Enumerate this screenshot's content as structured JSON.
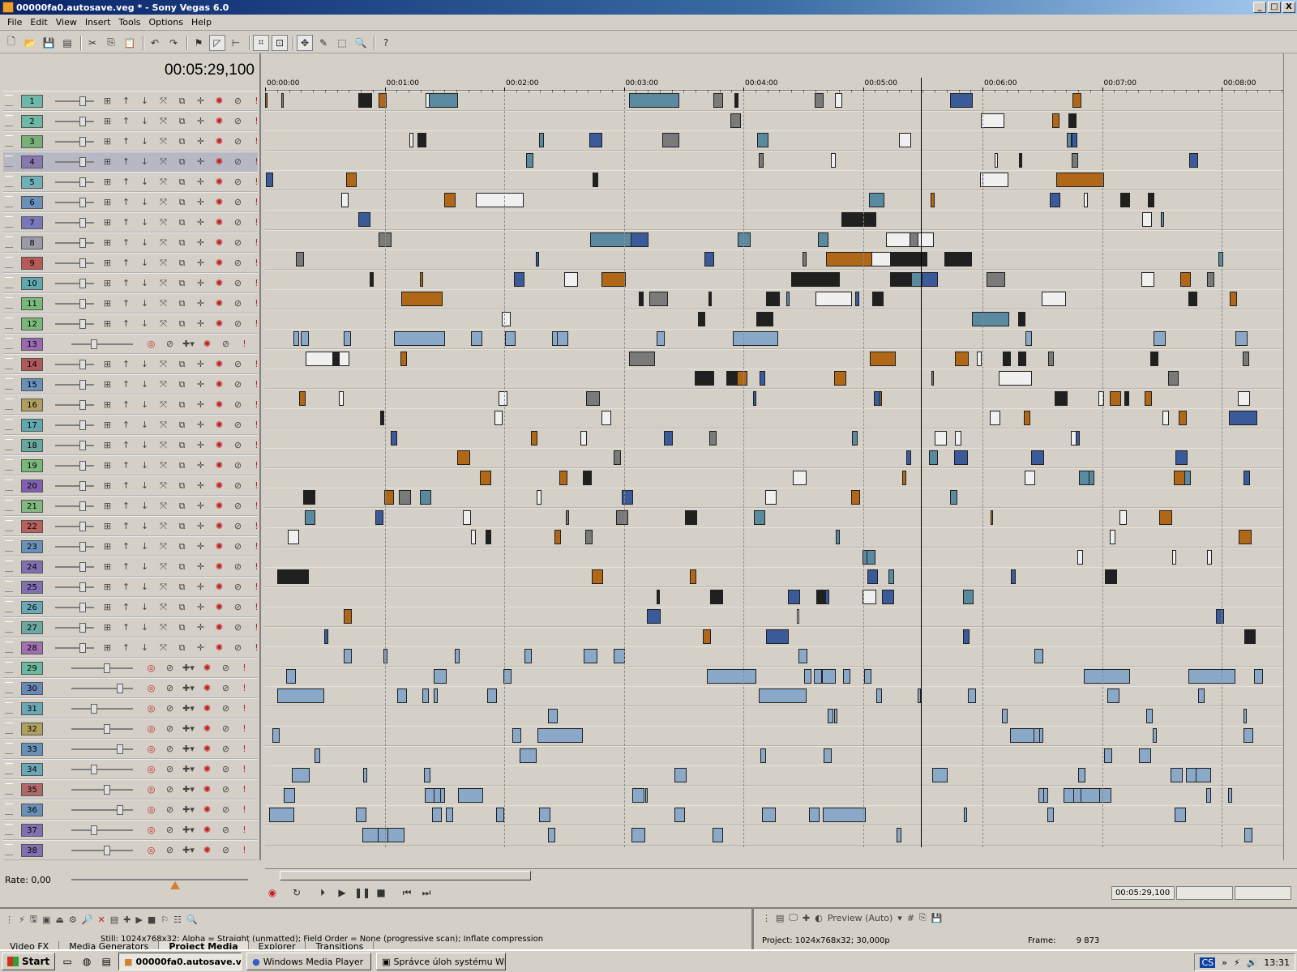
{
  "window": {
    "title": "00000fa0.autosave.veg * - Sony Vegas 6.0",
    "min": "_",
    "max": "□",
    "close": "X"
  },
  "menu": [
    "File",
    "Edit",
    "View",
    "Insert",
    "Tools",
    "Options",
    "Help"
  ],
  "timecode": "00:05:29,100",
  "ruler": [
    "00:00:00",
    "00:01:00",
    "00:02:00",
    "00:03:00",
    "00:04:00",
    "00:05:00",
    "00:06:00",
    "00:07:00",
    "00:08:00"
  ],
  "tracks": [
    {
      "n": "1",
      "c": "#6fb8a8",
      "kind": "video"
    },
    {
      "n": "2",
      "c": "#6fb8a8",
      "kind": "video"
    },
    {
      "n": "3",
      "c": "#78b078",
      "kind": "video"
    },
    {
      "n": "4",
      "c": "#8878b0",
      "kind": "video",
      "sel": true
    },
    {
      "n": "5",
      "c": "#6fb0b8",
      "kind": "video"
    },
    {
      "n": "6",
      "c": "#6890b8",
      "kind": "video"
    },
    {
      "n": "7",
      "c": "#7878b8",
      "kind": "video"
    },
    {
      "n": "8",
      "c": "#9a9aa8",
      "kind": "video"
    },
    {
      "n": "9",
      "c": "#b85858",
      "kind": "video"
    },
    {
      "n": "10",
      "c": "#60a8b0",
      "kind": "video"
    },
    {
      "n": "11",
      "c": "#78b878",
      "kind": "video"
    },
    {
      "n": "12",
      "c": "#78b878",
      "kind": "video"
    },
    {
      "n": "13",
      "c": "#9868b0",
      "kind": "audio"
    },
    {
      "n": "14",
      "c": "#b05858",
      "kind": "video"
    },
    {
      "n": "15",
      "c": "#6890b8",
      "kind": "video"
    },
    {
      "n": "16",
      "c": "#b0a060",
      "kind": "video"
    },
    {
      "n": "17",
      "c": "#60a8b0",
      "kind": "video"
    },
    {
      "n": "18",
      "c": "#68a8a0",
      "kind": "video"
    },
    {
      "n": "19",
      "c": "#78b878",
      "kind": "video"
    },
    {
      "n": "20",
      "c": "#8060b0",
      "kind": "video"
    },
    {
      "n": "21",
      "c": "#80b880",
      "kind": "video"
    },
    {
      "n": "22",
      "c": "#b86060",
      "kind": "video"
    },
    {
      "n": "23",
      "c": "#6890b8",
      "kind": "video"
    },
    {
      "n": "24",
      "c": "#8070b0",
      "kind": "video"
    },
    {
      "n": "25",
      "c": "#8070b0",
      "kind": "video"
    },
    {
      "n": "26",
      "c": "#6aa8b8",
      "kind": "video"
    },
    {
      "n": "27",
      "c": "#6aa8a0",
      "kind": "video"
    },
    {
      "n": "28",
      "c": "#a070b0",
      "kind": "video"
    },
    {
      "n": "29",
      "c": "#6ab8a0",
      "kind": "audio"
    },
    {
      "n": "30",
      "c": "#6888b8",
      "kind": "audio"
    },
    {
      "n": "31",
      "c": "#6aa8b8",
      "kind": "audio"
    },
    {
      "n": "32",
      "c": "#b0a060",
      "kind": "audio"
    },
    {
      "n": "33",
      "c": "#6890b8",
      "kind": "audio"
    },
    {
      "n": "34",
      "c": "#6aa8b8",
      "kind": "audio"
    },
    {
      "n": "35",
      "c": "#b06868",
      "kind": "audio"
    },
    {
      "n": "36",
      "c": "#6890b8",
      "kind": "audio"
    },
    {
      "n": "37",
      "c": "#8070b0",
      "kind": "audio"
    },
    {
      "n": "38",
      "c": "#8070b0",
      "kind": "audio"
    }
  ],
  "rate": "Rate: 0,00",
  "transport_tc": "00:05:29,100",
  "preview_label": "Preview (Auto)",
  "media_info": "Still: 1024x768x32; Alpha = Straight (unmatted); Field Order = None (progressive scan); Inflate compression",
  "dock_tabs": [
    "Video FX",
    "Media Generators",
    "Project Media",
    "Explorer",
    "Transitions"
  ],
  "project": {
    "label": "Project:",
    "value": "1024x768x32; 30,000p"
  },
  "frame": {
    "label": "Frame:",
    "value": "9 873"
  },
  "taskbar": {
    "start": "Start",
    "tasks": [
      "00000fa0.autosave.v...",
      "Windows Media Player",
      "Správce úloh systému Wi..."
    ],
    "clock": "13:31",
    "lang": "CS"
  }
}
